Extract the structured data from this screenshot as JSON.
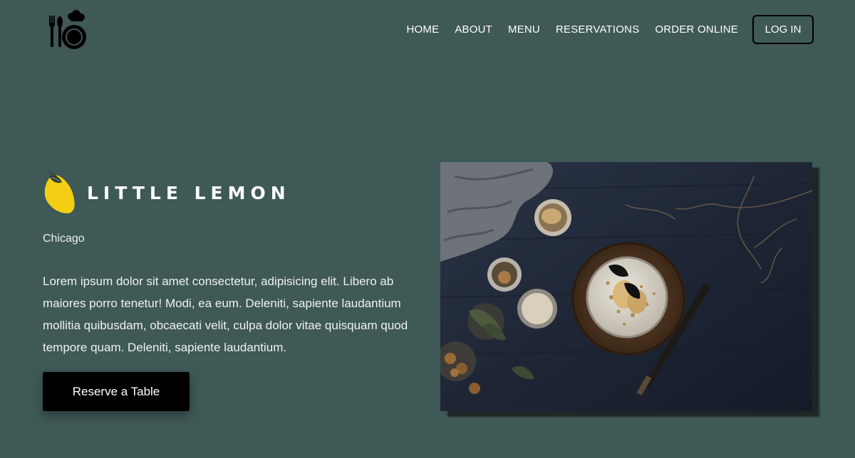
{
  "header": {
    "logo_icon": "restaurant-logo-icon",
    "nav": [
      {
        "label": "HOME"
      },
      {
        "label": "ABOUT"
      },
      {
        "label": "MENU"
      },
      {
        "label": "RESERVATIONS"
      },
      {
        "label": "ORDER ONLINE"
      }
    ],
    "login_label": "LOG IN"
  },
  "hero": {
    "brand_icon": "lemon-icon",
    "brand_name": "LITTLE LEMON",
    "city": "Chicago",
    "description": "Lorem ipsum dolor sit amet consectetur, adipisicing elit. Libero ab maiores porro tenetur! Modi, ea eum. Deleniti, sapiente laudantium mollitia quibusdam, obcaecati velit, culpa dolor vitae quisquam quod tempore quam. Deleniti, sapiente laudantium.",
    "reserve_label": "Reserve a Table",
    "image_subject": "cake-with-pears-on-dark-table"
  },
  "colors": {
    "background": "#3f5956",
    "button": "#000000",
    "lemon": "#f4ce14",
    "text": "#ffffff"
  }
}
